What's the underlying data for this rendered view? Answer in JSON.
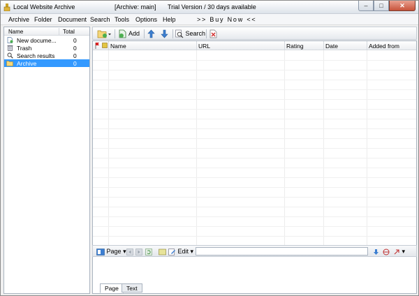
{
  "window": {
    "app_title": "Local Website Archive",
    "archive_title": "[Archive: main]",
    "trial_notice": "Trial Version / 30 days available",
    "minimize_label": "–",
    "maximize_label": "□",
    "close_label": "✕"
  },
  "menu": {
    "items": [
      "Archive",
      "Folder",
      "Document",
      "Search",
      "Tools",
      "Options",
      "Help"
    ],
    "buy_now": ">> Buy  Now <<"
  },
  "folders": {
    "header_name": "Name",
    "header_total": "Total",
    "items": [
      {
        "label": "New docume...",
        "count": "0",
        "icon": "new-document-icon"
      },
      {
        "label": "Trash",
        "count": "0",
        "icon": "trash-icon"
      },
      {
        "label": "Search results",
        "count": "0",
        "icon": "search-results-icon"
      },
      {
        "label": "Archive",
        "count": "0",
        "icon": "folder-icon",
        "selected": true
      }
    ]
  },
  "toolbar": {
    "add_label": "Add",
    "search_label": "Search"
  },
  "document_list": {
    "columns": [
      "Name",
      "URL",
      "Rating",
      "Date",
      "Added from"
    ],
    "rows": []
  },
  "preview_toolbar": {
    "page_label": "Page",
    "edit_label": "Edit",
    "url_value": ""
  },
  "preview": {
    "tabs": [
      "Page",
      "Text"
    ],
    "active_tab": "Page"
  },
  "colors": {
    "selection": "#3399ff",
    "window_bg": "#f0f0f0"
  }
}
